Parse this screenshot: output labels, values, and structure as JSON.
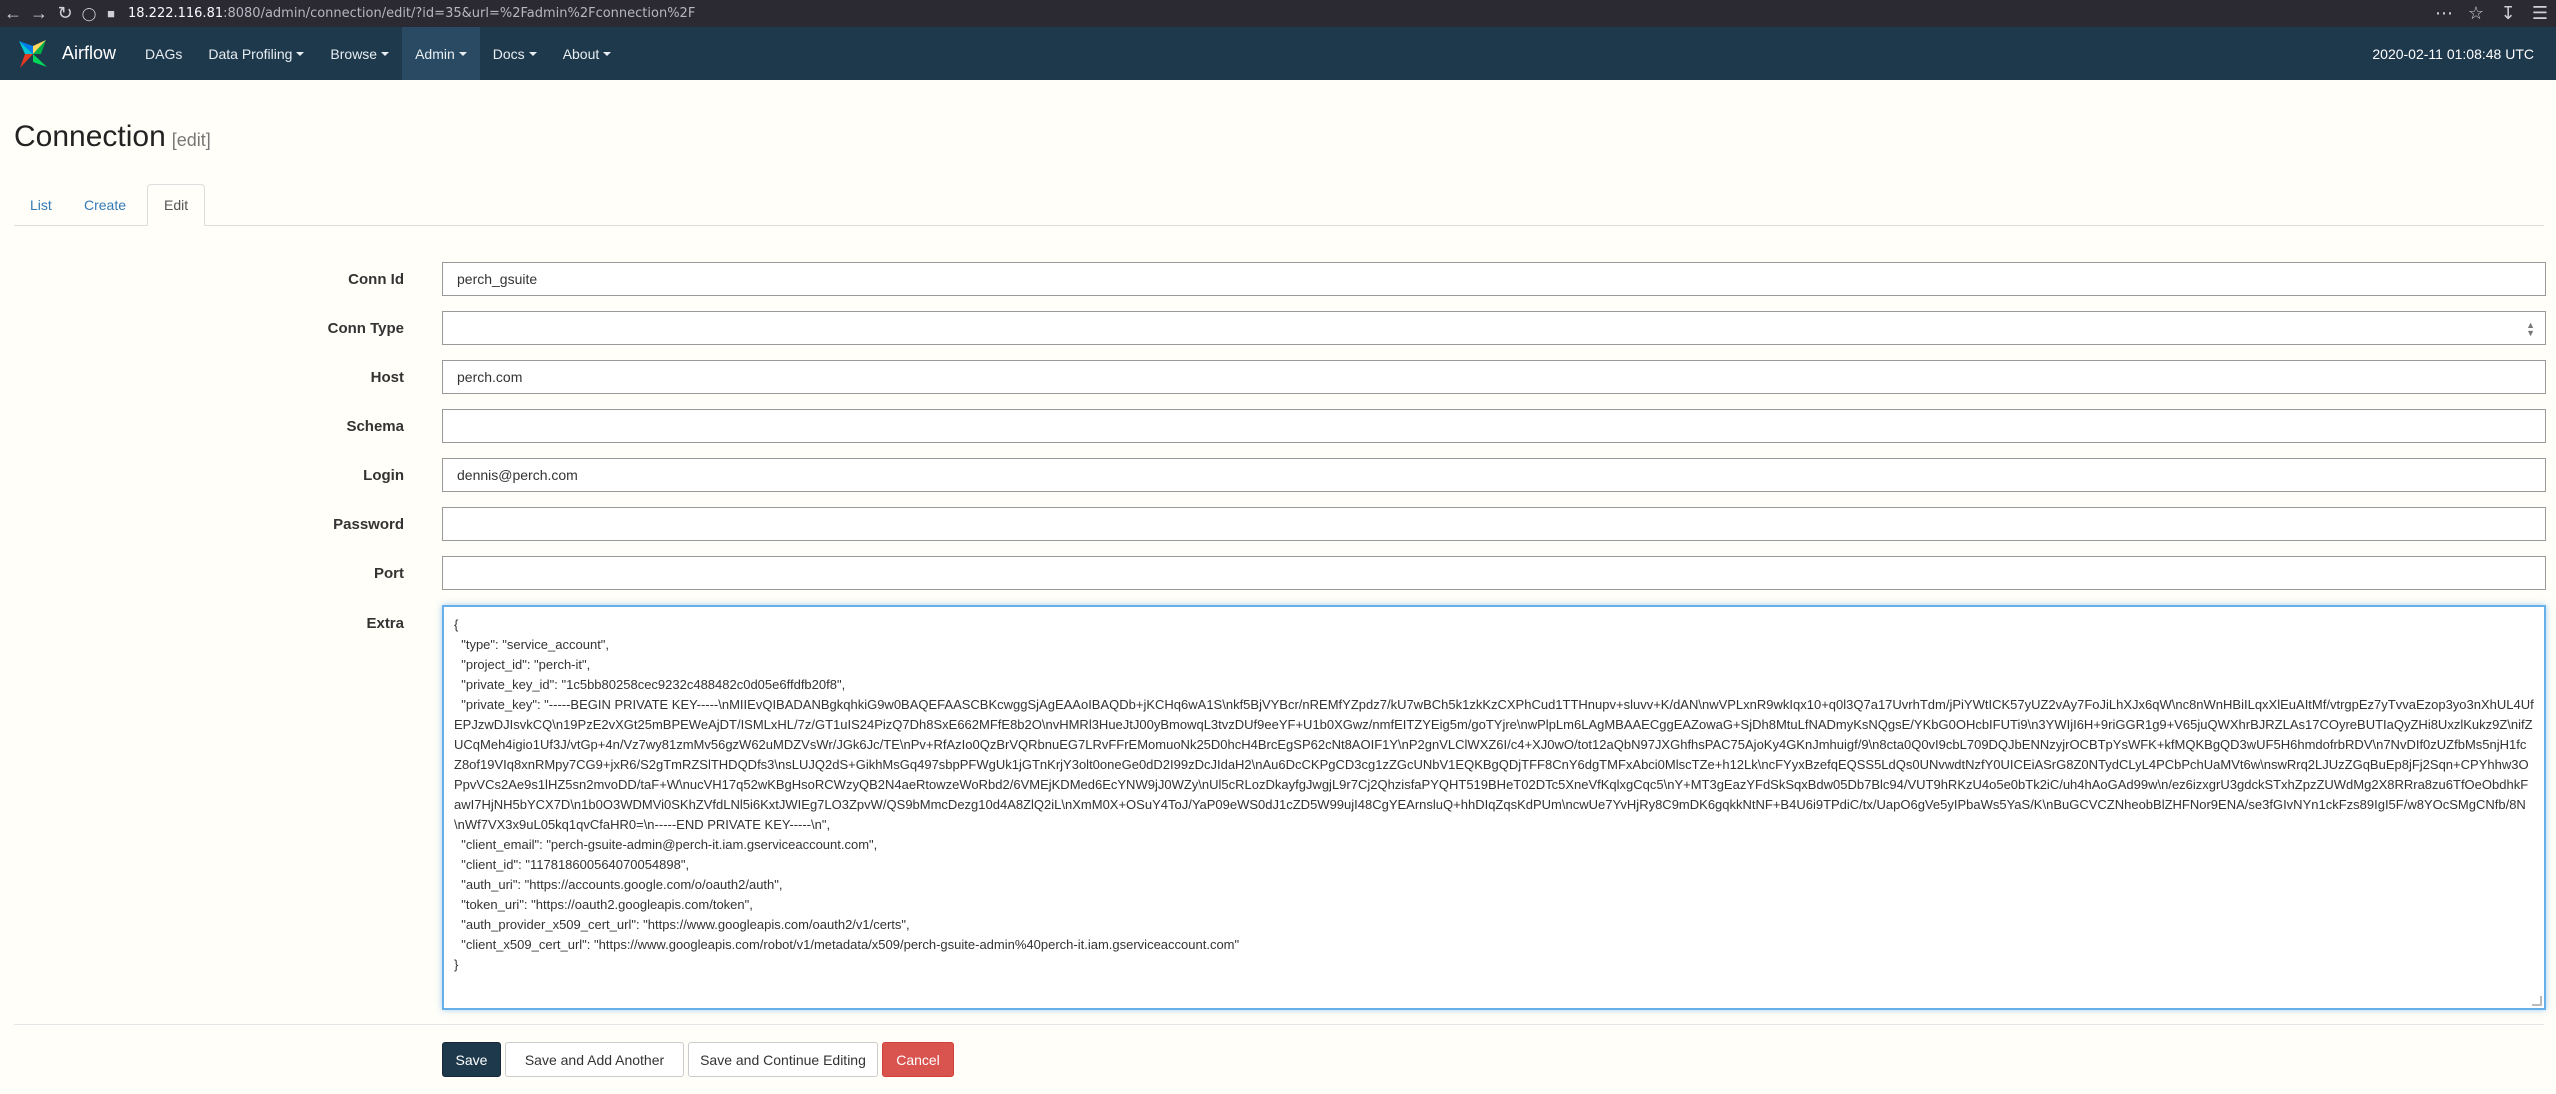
{
  "browser": {
    "url_host": "18.222.116.81",
    "url_rest": ":8080/admin/connection/edit/?id=35&url=%2Fadmin%2Fconnection%2F"
  },
  "navbar": {
    "brand": "Airflow",
    "menu": [
      {
        "label": "DAGs",
        "has_caret": false
      },
      {
        "label": "Data Profiling",
        "has_caret": true
      },
      {
        "label": "Browse",
        "has_caret": true
      },
      {
        "label": "Admin",
        "has_caret": true
      },
      {
        "label": "Docs",
        "has_caret": true
      },
      {
        "label": "About",
        "has_caret": true
      }
    ],
    "clock": "2020-02-11 01:08:48 UTC"
  },
  "page": {
    "title": "Connection",
    "subtitle": "[edit]"
  },
  "tabs": {
    "list": "List",
    "create": "Create",
    "edit": "Edit"
  },
  "form": {
    "conn_id": {
      "label": "Conn Id",
      "value": "perch_gsuite"
    },
    "conn_type": {
      "label": "Conn Type",
      "value": ""
    },
    "host": {
      "label": "Host",
      "value": "perch.com"
    },
    "schema": {
      "label": "Schema",
      "value": ""
    },
    "login": {
      "label": "Login",
      "value": "dennis@perch.com"
    },
    "password": {
      "label": "Password",
      "value": ""
    },
    "port": {
      "label": "Port",
      "value": ""
    },
    "extra": {
      "label": "Extra",
      "lines": [
        "{",
        "  \"type\": \"service_account\",",
        "  \"project_id\": \"perch-it\",",
        "  \"private_key_id\": \"1c5bb80258cec9232c488482c0d05e6ffdfb20f8\",",
        "  \"private_key\": \"-----BEGIN PRIVATE KEY-----\\nMIIEvQIBADANBgkqhkiG9w0BAQEFAASCBKcwggSjAgEAAoIBAQDb+jKCHq6wA1S\\nkf5BjVYBcr/nREMfYZpdz7/kU7wBCh5k1zkKzCXPhCud1TTHnupv+sluvv+K/dAN\\nwVPLxnR9wkIqx10+q0l3Q7a17UvrhTdm/jPiYWtICK57yUZ2vAy7FoJiLhXJx6qW\\nc8nWnHBiILqxXlEuAItMf/vtrgpEz7yTvvaEzop3yo3nXhUL4UfEPJzwDJIsvkCQ\\n19PzE2vXGt25mBPEWeAjDT/ISMLxHL/7z/GT1uIS24PizQ7Dh8SxE662MFfE8b2O\\nvHMRl3HueJtJ00yBmowqL3tvzDUf9eeYF+U1b0XGwz/nmfEITZYEig5m/goTYjre\\nwPlpLm6LAgMBAAECggEAZowaG+SjDh8MtuLfNADmyKsNQgsE/YKbG0OHcbIFUTi9\\n3YWIjI6H+9riGGR1g9+V65juQWXhrBJRZLAs17COyreBUTIaQyZHi8UxzlKukz9Z\\nifZUCqMeh4igio1Uf3J/vtGp+4n/Vz7wy81zmMv56gzW62uMDZVsWr/JGk6Jc/TE\\nPv+RfAzIo0QzBrVQRbnuEG7LRvFFrEMomuoNk25D0hcH4BrcEgSP62cNt8AOIF1Y\\nP2gnVLClWXZ6I/c4+XJ0wO/tot12aQbN97JXGhfhsPAC75AjoKy4GKnJmhuigf/9\\n8cta0Q0vI9cbL709DQJbENNzyjrOCBTpYsWFK+kfMQKBgQD3wUF5H6hmdofrbRDV\\n7NvDIf0zUZfbMs5njH1fcZ8of19VIq8xnRMpy7CG9+jxR6/S2gTmRZSlTHDQDfs3\\nsLUJQ2dS+GikhMsGq497sbpPFWgUk1jGTnKrjY3olt0oneGe0dD2I99zDcJIdaH2\\nAu6DcCKPgCD3cg1zZGcUNbV1EQKBgQDjTFF8CnY6dgTMFxAbci0MlscTZe+h12Lk\\ncFYyxBzefqEQSS5LdQs0UNvwdtNzfY0UICEiASrG8Z0NTydCLyL4PCbPchUaMVt6w\\nswRrq2LJUzZGqBuEp8jFj2Sqn+CPYhhw3OPpvVCs2Ae9s1lHZ5sn2mvoDD/taF+W\\nucVH17q52wKBgHsoRCWzyQB2N4aeRtowzeWoRbd2/6VMEjKDMed6EcYNW9jJ0WZy\\nUl5cRLozDkayfgJwgjL9r7Cj2QhzisfaPYQHT519BHeT02DTc5XneVfKqlxgCqc5\\nY+MT3gEazYFdSkSqxBdw05Db7Blc94/VUT9hRKzU4o5e0bTk2iC/uh4hAoGAd99w\\n/ez6izxgrU3gdckSTxhZpzZUWdMg2X8RRra8zu6TfOeObdhkFawI7HjNH5bYCX7D\\n1b0O3WDMVi0SKhZVfdLNl5i6KxtJWIEg7LO3ZpvW/QS9bMmcDezg10d4A8ZlQ2iL\\nXmM0X+OSuY4ToJ/YaP09eWS0dJ1cZD5W99ujI48CgYEArnsluQ+hhDIqZqsKdPUm\\ncwUe7YvHjRy8C9mDK6gqkkNtNF+B4U6i9TPdiC/tx/UapO6gVe5yIPbaWs5YaS/K\\nBuGCVCZNheobBlZHFNor9ENA/se3fGIvNYn1ckFzs89IgI5F/w8YOcSMgCNfb/8N\\nWf7VX3x9uL05kq1qvCfaHR0=\\n-----END PRIVATE KEY-----\\n\",",
        "  \"client_email\": \"perch-gsuite-admin@perch-it.iam.gserviceaccount.com\",",
        "  \"client_id\": \"117818600564070054898\",",
        "  \"auth_uri\": \"https://accounts.google.com/o/oauth2/auth\",",
        "  \"token_uri\": \"https://oauth2.googleapis.com/token\",",
        "  \"auth_provider_x509_cert_url\": \"https://www.googleapis.com/oauth2/v1/certs\",",
        "  \"client_x509_cert_url\": \"https://www.googleapis.com/robot/v1/metadata/x509/perch-gsuite-admin%40perch-it.iam.gserviceaccount.com\"",
        "}"
      ]
    }
  },
  "buttons": {
    "save": "Save",
    "save_add": "Save and Add Another",
    "save_continue": "Save and Continue Editing",
    "cancel": "Cancel"
  },
  "colors": {
    "navbar": "#1e384c",
    "save_button": "#1e384c",
    "cancel_button": "#d9534f",
    "focus_border": "#66afe9"
  }
}
